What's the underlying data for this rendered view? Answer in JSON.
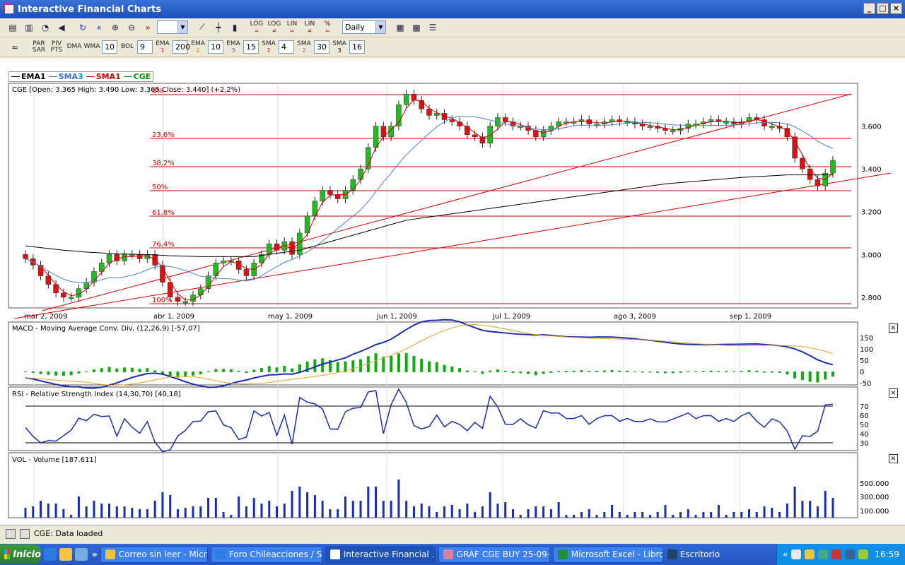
{
  "window": {
    "title": "Interactive Financial Charts"
  },
  "toolbar1": {
    "period_value": "",
    "interval_value": "Daily",
    "btn_log_eq": "LOG",
    "btn_log_neq": "LOG",
    "btn_lin_eq": "LIN",
    "btn_lin_neq": "LIN",
    "btn_pct": "%"
  },
  "toolbar2": {
    "par_sar": [
      "PAR",
      "SAR"
    ],
    "piv_pts": [
      "PIV",
      "PTS"
    ],
    "dma": "DMA",
    "wma": "WMA",
    "wma_value": "10",
    "bol": "BOL",
    "bol_value": "9",
    "ema1": [
      "EMA",
      "1"
    ],
    "ema1_value": "200",
    "ema2": [
      "EMA",
      "2"
    ],
    "ema2_value": "10",
    "ema3": [
      "EMA",
      "3"
    ],
    "ema3_value": "15",
    "sma1": [
      "SMA",
      "1"
    ],
    "sma1_value": "4",
    "sma2": [
      "SMA",
      "2"
    ],
    "sma2_value": "30",
    "sma3": [
      "SMA",
      "3"
    ],
    "sma3_value": "16"
  },
  "legend": [
    {
      "name": "EMA1",
      "color": "#000000"
    },
    {
      "name": "SMA3",
      "color": "#3c6fd0"
    },
    {
      "name": "SMA1",
      "color": "#cc0000"
    },
    {
      "name": "CGE",
      "color": "#009900"
    }
  ],
  "price_pane": {
    "caption": "CGE [Open: 3.365  High: 3.490  Low: 3.365  Close: 3.440] (+2,2%)",
    "y_ticks": [
      "3.600",
      "3.400",
      "3.200",
      "3.000",
      "2.800"
    ],
    "x_ticks": [
      "mar 2, 2009",
      "abr 1, 2009",
      "may 1, 2009",
      "jun 1, 2009",
      "jul 1, 2009",
      "ago 3, 2009",
      "sep 1, 2009"
    ],
    "fib_labels": [
      "0%",
      "23,6%",
      "38,2%",
      "50%",
      "61,8%",
      "76,4%",
      "100%"
    ]
  },
  "macd_pane": {
    "caption": "MACD - Moving Average Conv. Div. (12,26,9) [-57,07]",
    "y_ticks": [
      "150",
      "100",
      "50",
      "0",
      "-50"
    ]
  },
  "rsi_pane": {
    "caption": "RSI - Relative Strength Index (14,30,70) [40,18]",
    "y_ticks": [
      "70",
      "60",
      "50",
      "40",
      "30"
    ]
  },
  "vol_pane": {
    "caption": "VOL - Volume [187.611]",
    "y_ticks": [
      "500.000",
      "300.000",
      "100.000"
    ]
  },
  "chart_data": {
    "type": "candlestick",
    "series": [
      {
        "name": "CGE",
        "close": [
          2.98,
          2.95,
          2.9,
          2.86,
          2.82,
          2.8,
          2.8,
          2.84,
          2.87,
          2.92,
          2.96,
          3.0,
          2.97,
          3.0,
          3.0,
          2.98,
          3.0,
          2.95,
          2.87,
          2.8,
          2.78,
          2.78,
          2.81,
          2.84,
          2.9,
          2.96,
          2.97,
          2.97,
          2.93,
          2.9,
          2.96,
          3.0,
          3.05,
          3.02,
          3.06,
          3.0,
          3.1,
          3.18,
          3.25,
          3.3,
          3.28,
          3.26,
          3.3,
          3.35,
          3.4,
          3.5,
          3.6,
          3.55,
          3.6,
          3.7,
          3.75,
          3.72,
          3.68,
          3.65,
          3.66,
          3.63,
          3.62,
          3.6,
          3.56,
          3.55,
          3.52,
          3.6,
          3.64,
          3.62,
          3.6,
          3.6,
          3.58,
          3.55,
          3.58,
          3.6,
          3.62,
          3.62,
          3.62,
          3.63,
          3.61,
          3.61,
          3.62,
          3.63,
          3.62,
          3.62,
          3.61,
          3.6,
          3.6,
          3.59,
          3.58,
          3.58,
          3.59,
          3.61,
          3.61,
          3.62,
          3.63,
          3.62,
          3.62,
          3.61,
          3.62,
          3.64,
          3.63,
          3.6,
          3.6,
          3.59,
          3.55,
          3.45,
          3.4,
          3.35,
          3.32,
          3.38,
          3.44
        ]
      },
      {
        "name": "EMA1",
        "values": [
          3.04,
          3.036,
          3.032,
          3.028,
          3.024,
          3.02,
          3.017,
          3.014,
          3.011,
          3.009,
          3.007,
          3.005,
          3.003,
          3.002,
          3.001,
          3.0,
          2.999,
          2.998,
          2.996,
          2.994,
          2.993,
          2.992,
          2.991,
          2.99,
          2.99,
          2.99,
          2.99,
          2.99,
          2.99,
          2.99,
          2.99,
          2.995,
          3.0,
          3.005,
          3.01,
          3.015,
          3.02,
          3.03,
          3.04,
          3.05,
          3.06,
          3.07,
          3.08,
          3.09,
          3.1,
          3.11,
          3.12,
          3.13,
          3.14,
          3.15,
          3.16,
          3.165,
          3.17,
          3.175,
          3.18,
          3.185,
          3.19,
          3.195,
          3.2,
          3.205,
          3.21,
          3.215,
          3.22,
          3.225,
          3.23,
          3.235,
          3.24,
          3.245,
          3.25,
          3.255,
          3.26,
          3.265,
          3.27,
          3.275,
          3.28,
          3.285,
          3.29,
          3.295,
          3.3,
          3.305,
          3.31,
          3.315,
          3.32,
          3.325,
          3.33,
          3.333,
          3.336,
          3.339,
          3.342,
          3.345,
          3.348,
          3.351,
          3.354,
          3.357,
          3.36,
          3.362,
          3.364,
          3.366,
          3.368,
          3.37,
          3.372,
          3.372,
          3.372,
          3.372,
          3.372,
          3.372,
          3.372
        ]
      }
    ],
    "ylim": [
      2.75,
      3.8
    ]
  }
}
